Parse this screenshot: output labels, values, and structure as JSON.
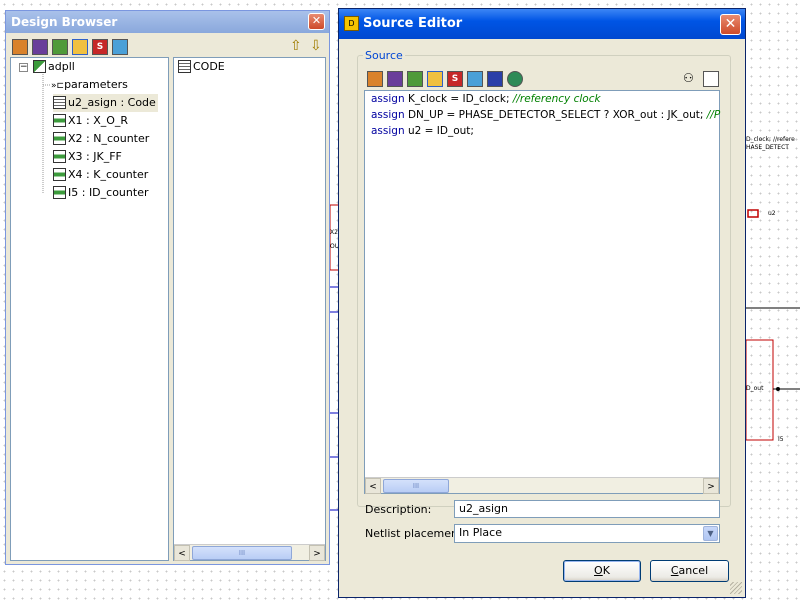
{
  "background": {
    "labels": {
      "id_clock": "D_clock; //refere",
      "phase": "HASE_DETECT",
      "u2": "u2",
      "x2": "X2",
      "out": "OU",
      "id_out": "D_out",
      "i5": "I5"
    }
  },
  "design_browser": {
    "title": "Design Browser",
    "close_glyph": "✕",
    "toolbar": {
      "s_icon_label": "S",
      "up_arrow": "⇧",
      "down_arrow": "⇩"
    },
    "tree": {
      "root": {
        "label": "adpll",
        "expander": "−"
      },
      "items": [
        {
          "label": "parameters",
          "icon": "parameter-arrow-icon"
        },
        {
          "label": "u2_asign : Code",
          "icon": "code-document-icon"
        },
        {
          "label": "X1 : X_O_R",
          "icon": "instance-icon"
        },
        {
          "label": "X2 : N_counter",
          "icon": "instance-icon"
        },
        {
          "label": "X3 : JK_FF",
          "icon": "instance-icon"
        },
        {
          "label": "X4 : K_counter",
          "icon": "instance-icon"
        },
        {
          "label": "I5 : ID_counter",
          "icon": "instance-icon"
        }
      ]
    },
    "detail_pane": {
      "items": [
        {
          "label": "CODE",
          "icon": "code-document-icon"
        }
      ]
    },
    "scroll": {
      "left": "<",
      "right": ">",
      "thumb": "III"
    }
  },
  "source_editor": {
    "title": "Source Editor",
    "close_glyph": "✕",
    "group_label": "Source",
    "toolbar": {
      "s_icon_label": "S"
    },
    "code_lines": [
      {
        "kw": "assign",
        "body": " K_clock = ID_clock;  ",
        "comment": "//referency clock"
      },
      {
        "kw": "assign",
        "body": " DN_UP = PHASE_DETECTOR_SELECT ? XOR_out : JK_out; ",
        "comment": "//P"
      },
      {
        "kw": "assign",
        "body": " u2 = ID_out;",
        "comment": ""
      }
    ],
    "scroll": {
      "left": "<",
      "right": ">",
      "thumb": "III"
    },
    "description": {
      "label": "Description:",
      "value": "u2_asign"
    },
    "netlist": {
      "label": "Netlist placement:",
      "value": "In Place",
      "arrow": "▼"
    },
    "buttons": {
      "ok_mnemonic": "O",
      "ok_rest": "K",
      "cancel_pre": "",
      "cancel_mnemonic": "C",
      "cancel_rest": "ancel"
    }
  },
  "colors": {
    "xp_title_blue": "#0055e5",
    "inactive_title": "#8aa8dc",
    "window_face": "#ece9d8",
    "schematic_wire_red": "#c00000",
    "schematic_wire_blue": "#0000c0",
    "comment_green": "#008000",
    "keyword_blue": "#0000a0"
  }
}
